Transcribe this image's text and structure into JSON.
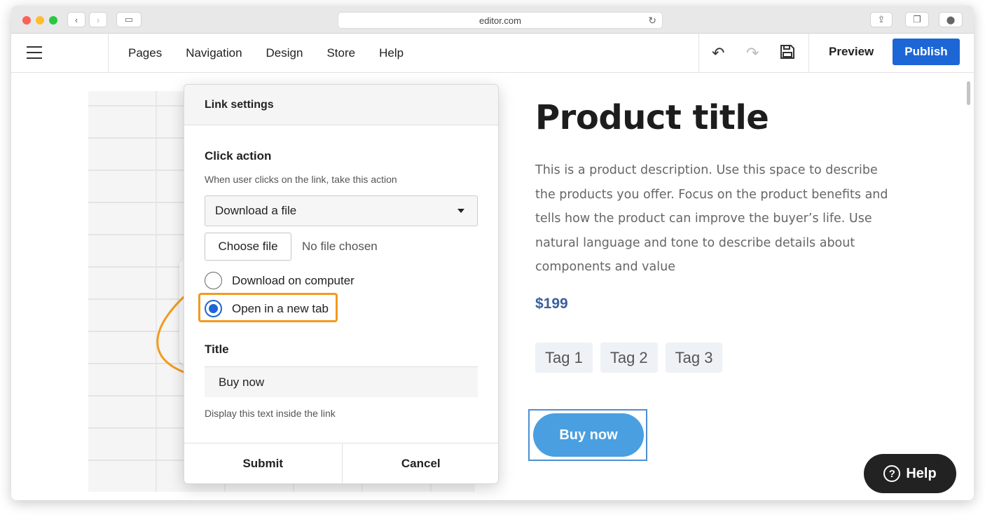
{
  "browser": {
    "url": "editor.com"
  },
  "topbar": {
    "nav": [
      "Pages",
      "Navigation",
      "Design",
      "Store",
      "Help"
    ],
    "preview_label": "Preview",
    "publish_label": "Publish"
  },
  "product": {
    "title": "Product title",
    "description": "This is a product description. Use this space to describe the products you offer. Focus on the product benefits and tells how the product can improve the buyer’s life. Use natural language and tone to describe details about components and value",
    "price": "$199",
    "tags": [
      "Tag 1",
      "Tag 2",
      "Tag 3"
    ],
    "buy_label": "Buy now"
  },
  "help_button": {
    "label": "Help"
  },
  "dialog": {
    "title": "Link settings",
    "click_action": {
      "label": "Click action",
      "help": "When user clicks on the link, take this action",
      "selected": "Download a file"
    },
    "file": {
      "button": "Choose file",
      "status": "No file chosen"
    },
    "options": {
      "download": "Download on computer",
      "new_tab": "Open in a new tab",
      "selected": "new_tab"
    },
    "title_field": {
      "label": "Title",
      "value": "Buy now",
      "help": "Display this text inside the link"
    },
    "submit_label": "Submit",
    "cancel_label": "Cancel"
  },
  "colors": {
    "accent": "#1c66d6",
    "highlight": "#f39a1c",
    "buy_button": "#4a9fe0",
    "price": "#3a5f9c"
  }
}
